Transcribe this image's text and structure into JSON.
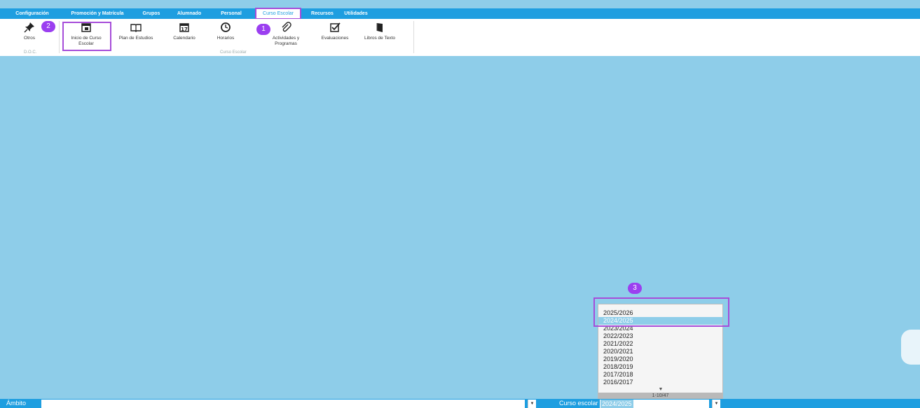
{
  "menu": [
    {
      "id": "configuracion",
      "label": "Configuración"
    },
    {
      "id": "promocion",
      "label": "Promoción y Matrícula"
    },
    {
      "id": "grupos",
      "label": "Grupos"
    },
    {
      "id": "alumnado",
      "label": "Alumnado"
    },
    {
      "id": "personal",
      "label": "Personal"
    },
    {
      "id": "curso-escolar",
      "label": "Curso Escolar",
      "active": true
    },
    {
      "id": "recursos",
      "label": "Recursos"
    },
    {
      "id": "utilidades",
      "label": "Utilidades"
    }
  ],
  "ribbon": {
    "buttons": [
      {
        "id": "otros",
        "label": "Otros",
        "icon": "pin-icon"
      },
      {
        "id": "inicio",
        "label": "Inicio de Curso Escolar",
        "icon": "calendar-plus-icon"
      },
      {
        "id": "plan",
        "label": "Plan de Estudios",
        "icon": "book-icon"
      },
      {
        "id": "calendario",
        "label": "Calendario",
        "icon": "calendar-17-icon",
        "icon_text": "17"
      },
      {
        "id": "horarios",
        "label": "Horarios",
        "icon": "clock-icon"
      },
      {
        "id": "actividades",
        "label": "Actividades y Programas",
        "icon": "paperclip-icon"
      },
      {
        "id": "evaluaciones",
        "label": "Evaluaciones",
        "icon": "checkbox-icon"
      },
      {
        "id": "libros",
        "label": "Libros de Texto",
        "icon": "textbook-icon"
      }
    ],
    "groups": {
      "doc": "D.O.C.",
      "curso": "Curso Escolar"
    }
  },
  "badges": {
    "one": "1",
    "two": "2",
    "three": "3"
  },
  "dropdown": {
    "items": [
      "2025/2026",
      "2024/2025",
      "2023/2024",
      "2022/2023",
      "2021/2022",
      "2020/2021",
      "2019/2020",
      "2018/2019",
      "2017/2018",
      "2016/2017"
    ],
    "selected_index": 1,
    "footer": "1-10/47"
  },
  "bottom": {
    "ambito_label": "Ámbito",
    "ambito_value": "",
    "curso_label": "Curso escolar",
    "curso_value": "2024/2025"
  },
  "colors": {
    "accent": "#1e9ee0",
    "canvas": "#8ecde9",
    "highlight": "#a64dd9",
    "badge": "#9b3ff0"
  }
}
